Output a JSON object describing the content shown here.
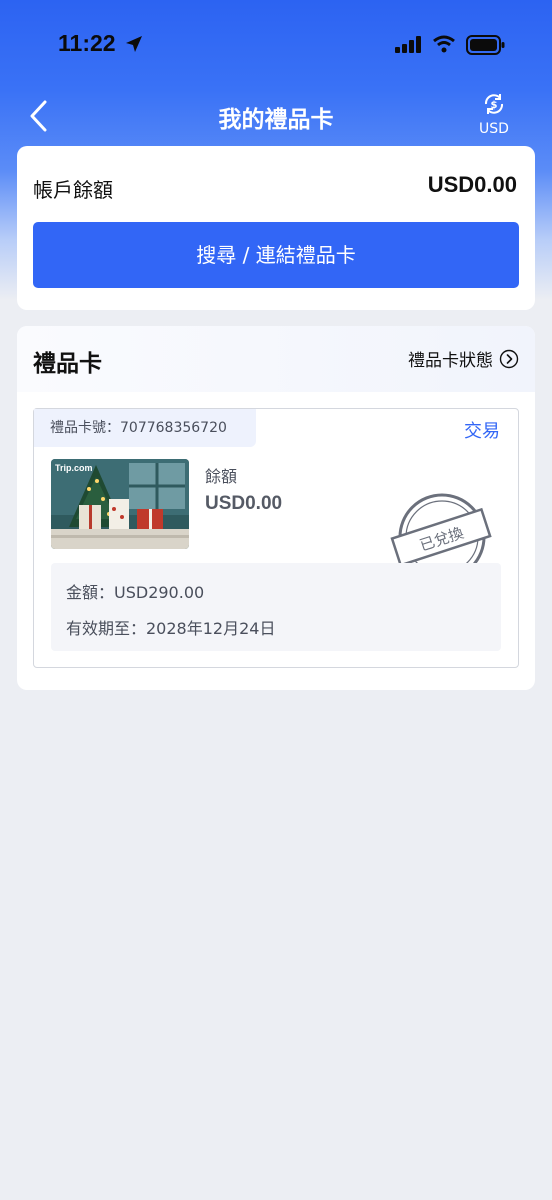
{
  "status_bar": {
    "time": "11:22"
  },
  "nav": {
    "title": "我的禮品卡",
    "currency_label": "USD"
  },
  "account_balance": {
    "label": "帳戶餘額",
    "value": "USD0.00",
    "search_link_button": "搜尋 / 連結禮品卡"
  },
  "gift_cards": {
    "title": "禮品卡",
    "status_link": "禮品卡狀態",
    "items": [
      {
        "number_label": "禮品卡號：707768356720",
        "trade_link": "交易",
        "image_brand": "Trip.com",
        "balance_label": "餘額",
        "balance_value": "USD0.00",
        "stamp_text": "已兌換",
        "amount": "金額：USD290.00",
        "expiry": "有效期至：2028年12月24日"
      }
    ]
  },
  "colors": {
    "accent": "#3266f6",
    "header_blue": "#2c63f2",
    "page_bg": "#eceef3"
  },
  "icons": [
    "back-chevron-icon",
    "currency-exchange-icon",
    "chevron-right-circle-icon",
    "location-arrow-icon",
    "signal-icon",
    "wifi-icon",
    "battery-icon"
  ]
}
